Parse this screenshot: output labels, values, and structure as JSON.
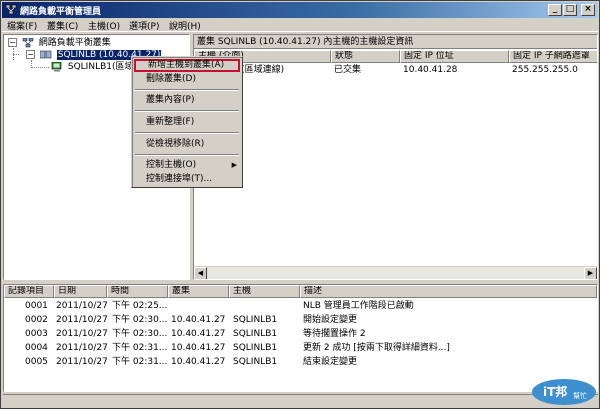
{
  "window": {
    "title": "網路負載平衡管理員",
    "minimize": "_",
    "maximize": "□",
    "close": "×"
  },
  "menu": [
    "檔案(F)",
    "叢集(C)",
    "主機(O)",
    "選項(P)",
    "說明(H)"
  ],
  "tree": {
    "root": "網路負載平衡叢集",
    "cluster": "SQLINLB (10.40.41.27)",
    "host": "SQLINLB1(區域"
  },
  "detail": {
    "header": "叢集 SQLINLB (10.40.41.27) 內主機的主機設定資訊",
    "columns": [
      "主機 (介面)",
      "狀態",
      "固定 IP 位址",
      "固定 IP 子網路遮罩"
    ],
    "rows": [
      [
        "SQLINLB1(區域連線)",
        "已交集",
        "10.40.41.28",
        "255.255.255.0"
      ]
    ]
  },
  "context_menu": {
    "items": [
      {
        "label": "新增主機到叢集(A)",
        "highlighted": true
      },
      {
        "label": "刪除叢集(D)"
      },
      {
        "separator": true
      },
      {
        "label": "叢集內容(P)"
      },
      {
        "separator": true
      },
      {
        "label": "重新整理(F)"
      },
      {
        "separator": true
      },
      {
        "label": "從檢視移除(R)"
      },
      {
        "separator": true
      },
      {
        "label": "控制主機(O)",
        "submenu": true
      },
      {
        "label": "控制連接埠(T)..."
      }
    ]
  },
  "log": {
    "columns": [
      "記錄項目",
      "日期",
      "時間",
      "叢集",
      "主機",
      "描述"
    ],
    "rows": [
      [
        "0001",
        "2011/10/27",
        "下午 02:25...",
        "",
        "",
        "NLB 管理員工作階段已啟動"
      ],
      [
        "0002",
        "2011/10/27",
        "下午 02:30...",
        "10.40.41.27",
        "SQLINLB1",
        "開始設定變更"
      ],
      [
        "0003",
        "2011/10/27",
        "下午 02:30...",
        "10.40.41.27",
        "SQLINLB1",
        "等待擱置操作 2"
      ],
      [
        "0004",
        "2011/10/27",
        "下午 02:31...",
        "10.40.41.27",
        "SQLINLB1",
        "更新 2 成功 [按兩下取得詳細資料...]"
      ],
      [
        "0005",
        "2011/10/27",
        "下午 02:31...",
        "10.40.41.27",
        "SQLINLB1",
        "結束設定變更"
      ]
    ]
  },
  "watermark": {
    "text": "iT邦",
    "sub": "幫忙"
  }
}
